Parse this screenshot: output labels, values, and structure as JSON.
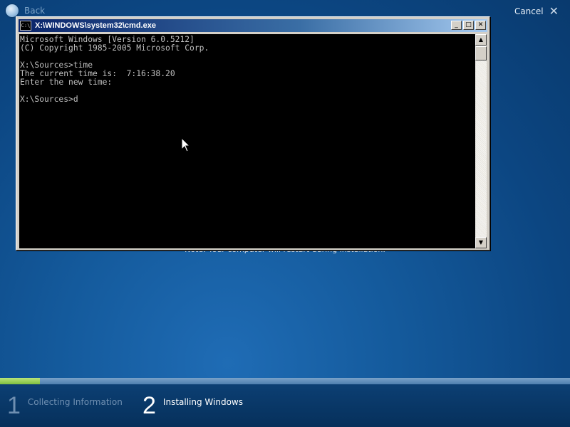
{
  "setup": {
    "back_label": "Back",
    "cancel_label": "Cancel",
    "note_text": "Note: Your computer will restart during installation.",
    "progress_fraction": 0.07,
    "colors": {
      "accent_progress": "#8fd14f",
      "background": "#0c4682"
    },
    "steps": [
      {
        "number": "1",
        "label": "Collecting Information",
        "state": "completed"
      },
      {
        "number": "2",
        "label": "Installing Windows",
        "state": "current"
      }
    ]
  },
  "cmd_window": {
    "title": "X:\\WINDOWS\\system32\\cmd.exe",
    "icon_glyph": "C:\\",
    "console_text": "Microsoft Windows [Version 6.0.5212]\n(C) Copyright 1985-2005 Microsoft Corp.\n\nX:\\Sources>time\nThe current time is:  7:16:38.20\nEnter the new time:\n\nX:\\Sources>d",
    "controls": {
      "minimize": "_",
      "maximize": "□",
      "close": "✕"
    },
    "scroll_up": "▲",
    "scroll_down": "▼"
  }
}
